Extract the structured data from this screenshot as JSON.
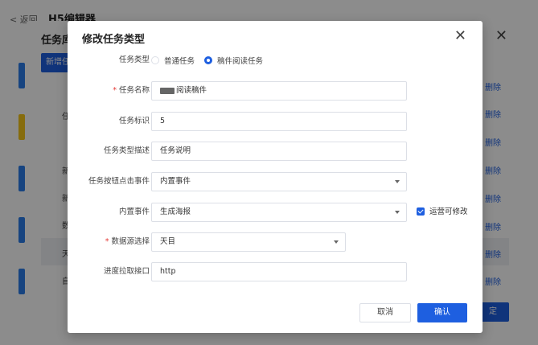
{
  "background": {
    "back_label": "< 返回",
    "title": "H5编辑器"
  },
  "outer_dialog": {
    "title": "任务库",
    "new_button": "新增任",
    "left_items": [
      "任",
      "新",
      "新加",
      "数",
      "天",
      "自"
    ],
    "delete_label": "删除",
    "delete_count": 8,
    "confirm_button": "定",
    "strip_colors": [
      "#2b7de9",
      "#f5c518",
      "#2b7de9",
      "#2b7de9",
      "#2b7de9"
    ]
  },
  "modal": {
    "title": "修改任务类型",
    "close_icon": "close-icon",
    "fields": {
      "task_type": {
        "label": "任务类型",
        "options": [
          "普通任务",
          "稿件阅读任务"
        ],
        "selected_index": 1
      },
      "task_name": {
        "label": "任务名称",
        "required": true,
        "value": "阅读稿件"
      },
      "task_id": {
        "label": "任务标识",
        "value": "5"
      },
      "type_desc": {
        "label": "任务类型描述",
        "value": "任务说明"
      },
      "click_event": {
        "label": "任务按钮点击事件",
        "value": "内置事件"
      },
      "builtin_event": {
        "label": "内置事件",
        "value": "生成海报",
        "checkbox_label": "运营可修改",
        "checkbox_checked": true
      },
      "data_source": {
        "label": "数据源选择",
        "required": true,
        "value": "天目"
      },
      "progress_api": {
        "label": "进度拉取接口",
        "value": "http"
      }
    },
    "cancel_button": "取消",
    "ok_button": "确认"
  },
  "colors": {
    "primary": "#1e5fe0",
    "required": "#e53935",
    "overlay": "rgba(0,0,0,0.45)"
  }
}
